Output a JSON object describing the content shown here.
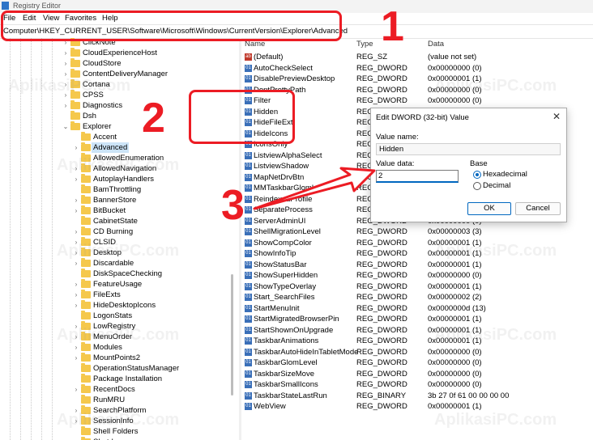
{
  "window": {
    "title": "Registry Editor"
  },
  "menu": [
    "File",
    "Edit",
    "View",
    "Favorites",
    "Help"
  ],
  "address": "Computer\\HKEY_CURRENT_USER\\Software\\Microsoft\\Windows\\CurrentVersion\\Explorer\\Advanced",
  "tree": [
    {
      "label": "ClickNote",
      "expander": "›"
    },
    {
      "label": "CloudExperienceHost",
      "expander": "›"
    },
    {
      "label": "CloudStore",
      "expander": "›"
    },
    {
      "label": "ContentDeliveryManager",
      "expander": "›"
    },
    {
      "label": "Cortana",
      "expander": "›"
    },
    {
      "label": "CPSS",
      "expander": "›"
    },
    {
      "label": "Diagnostics",
      "expander": "›"
    },
    {
      "label": "Dsh",
      "expander": ""
    },
    {
      "label": "Explorer",
      "expander": "⌄"
    },
    {
      "label": "Accent",
      "expander": ""
    },
    {
      "label": "Advanced",
      "expander": "›",
      "selected": true
    },
    {
      "label": "AllowedEnumeration",
      "expander": ""
    },
    {
      "label": "AllowedNavigation",
      "expander": "›"
    },
    {
      "label": "AutoplayHandlers",
      "expander": "›"
    },
    {
      "label": "BamThrottling",
      "expander": ""
    },
    {
      "label": "BannerStore",
      "expander": "›"
    },
    {
      "label": "BitBucket",
      "expander": "›"
    },
    {
      "label": "CabinetState",
      "expander": ""
    },
    {
      "label": "CD Burning",
      "expander": "›"
    },
    {
      "label": "CLSID",
      "expander": "›"
    },
    {
      "label": "Desktop",
      "expander": "›"
    },
    {
      "label": "Discardable",
      "expander": "›"
    },
    {
      "label": "DiskSpaceChecking",
      "expander": ""
    },
    {
      "label": "FeatureUsage",
      "expander": "›"
    },
    {
      "label": "FileExts",
      "expander": "›"
    },
    {
      "label": "HideDesktopIcons",
      "expander": "›"
    },
    {
      "label": "LogonStats",
      "expander": ""
    },
    {
      "label": "LowRegistry",
      "expander": "›"
    },
    {
      "label": "MenuOrder",
      "expander": "›"
    },
    {
      "label": "Modules",
      "expander": "›"
    },
    {
      "label": "MountPoints2",
      "expander": "›"
    },
    {
      "label": "OperationStatusManager",
      "expander": ""
    },
    {
      "label": "Package Installation",
      "expander": ""
    },
    {
      "label": "RecentDocs",
      "expander": "›"
    },
    {
      "label": "RunMRU",
      "expander": ""
    },
    {
      "label": "SearchPlatform",
      "expander": "›"
    },
    {
      "label": "SessionInfo",
      "expander": "›"
    },
    {
      "label": "Shell Folders",
      "expander": ""
    },
    {
      "label": "Shutdown",
      "expander": ""
    }
  ],
  "columns": {
    "name": "Name",
    "type": "Type",
    "data": "Data"
  },
  "values": [
    {
      "name": "(Default)",
      "type": "REG_SZ",
      "data": "(value not set)",
      "icon": "ab"
    },
    {
      "name": "AutoCheckSelect",
      "type": "REG_DWORD",
      "data": "0x00000000 (0)",
      "icon": "01"
    },
    {
      "name": "DisablePreviewDesktop",
      "type": "REG_DWORD",
      "data": "0x00000001 (1)",
      "icon": "01"
    },
    {
      "name": "DontPrettyPath",
      "type": "REG_DWORD",
      "data": "0x00000000 (0)",
      "icon": "01"
    },
    {
      "name": "Filter",
      "type": "REG_DWORD",
      "data": "0x00000000 (0)",
      "icon": "01"
    },
    {
      "name": "Hidden",
      "type": "REG_DWORD",
      "data": "",
      "icon": "01"
    },
    {
      "name": "HideFileExt",
      "type": "REG_DWORD",
      "data": "",
      "icon": "01"
    },
    {
      "name": "HideIcons",
      "type": "REG_DWORD",
      "data": "",
      "icon": "01"
    },
    {
      "name": "IconsOnly",
      "type": "REG_DWORD",
      "data": "",
      "icon": "01"
    },
    {
      "name": "ListviewAlphaSelect",
      "type": "REG_DWORD",
      "data": "",
      "icon": "01"
    },
    {
      "name": "ListviewShadow",
      "type": "REG_DWORD",
      "data": "",
      "icon": "01"
    },
    {
      "name": "MapNetDrvBtn",
      "type": "REG_DWORD",
      "data": "",
      "icon": "01"
    },
    {
      "name": "MMTaskbarGlomLevel",
      "type": "REG_DWORD",
      "data": "",
      "icon": "01"
    },
    {
      "name": "ReindexedProfile",
      "type": "REG_DWORD",
      "data": "",
      "icon": "01"
    },
    {
      "name": "SeparateProcess",
      "type": "REG_DWORD",
      "data": "",
      "icon": "01"
    },
    {
      "name": "ServerAdminUI",
      "type": "REG_DWORD",
      "data": "0x00000000 (0)",
      "icon": "01"
    },
    {
      "name": "ShellMigrationLevel",
      "type": "REG_DWORD",
      "data": "0x00000003 (3)",
      "icon": "01"
    },
    {
      "name": "ShowCompColor",
      "type": "REG_DWORD",
      "data": "0x00000001 (1)",
      "icon": "01"
    },
    {
      "name": "ShowInfoTip",
      "type": "REG_DWORD",
      "data": "0x00000001 (1)",
      "icon": "01"
    },
    {
      "name": "ShowStatusBar",
      "type": "REG_DWORD",
      "data": "0x00000001 (1)",
      "icon": "01"
    },
    {
      "name": "ShowSuperHidden",
      "type": "REG_DWORD",
      "data": "0x00000000 (0)",
      "icon": "01"
    },
    {
      "name": "ShowTypeOverlay",
      "type": "REG_DWORD",
      "data": "0x00000001 (1)",
      "icon": "01"
    },
    {
      "name": "Start_SearchFiles",
      "type": "REG_DWORD",
      "data": "0x00000002 (2)",
      "icon": "01"
    },
    {
      "name": "StartMenuInit",
      "type": "REG_DWORD",
      "data": "0x0000000d (13)",
      "icon": "01"
    },
    {
      "name": "StartMigratedBrowserPin",
      "type": "REG_DWORD",
      "data": "0x00000001 (1)",
      "icon": "01"
    },
    {
      "name": "StartShownOnUpgrade",
      "type": "REG_DWORD",
      "data": "0x00000001 (1)",
      "icon": "01"
    },
    {
      "name": "TaskbarAnimations",
      "type": "REG_DWORD",
      "data": "0x00000001 (1)",
      "icon": "01"
    },
    {
      "name": "TaskbarAutoHideInTabletMode",
      "type": "REG_DWORD",
      "data": "0x00000000 (0)",
      "icon": "01"
    },
    {
      "name": "TaskbarGlomLevel",
      "type": "REG_DWORD",
      "data": "0x00000000 (0)",
      "icon": "01"
    },
    {
      "name": "TaskbarSizeMove",
      "type": "REG_DWORD",
      "data": "0x00000000 (0)",
      "icon": "01"
    },
    {
      "name": "TaskbarSmallIcons",
      "type": "REG_DWORD",
      "data": "0x00000000 (0)",
      "icon": "01"
    },
    {
      "name": "TaskbarStateLastRun",
      "type": "REG_BINARY",
      "data": "3b 27 0f 61 00 00 00 00",
      "icon": "01"
    },
    {
      "name": "WebView",
      "type": "REG_DWORD",
      "data": "0x00000001 (1)",
      "icon": "01"
    }
  ],
  "dialog": {
    "title": "Edit DWORD (32-bit) Value",
    "close": "✕",
    "value_name_label": "Value name:",
    "value_name": "Hidden",
    "value_data_label": "Value data:",
    "value_data": "2",
    "base_label": "Base",
    "hex_label": "Hexadecimal",
    "dec_label": "Decimal",
    "ok": "OK",
    "cancel": "Cancel"
  },
  "annotations": {
    "n1": "1",
    "n2": "2",
    "n3": "3",
    "color": "#ec1c24"
  },
  "watermark": "AplikasiPC.com"
}
